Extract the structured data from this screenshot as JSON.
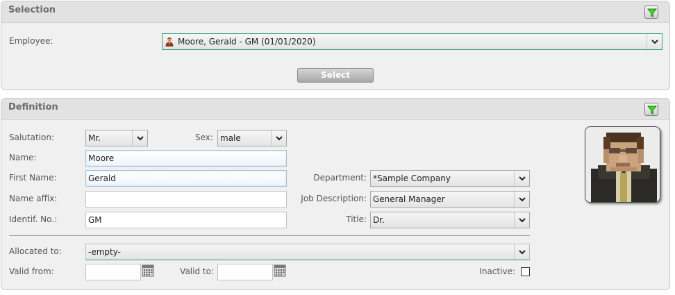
{
  "selection": {
    "title": "Selection",
    "employee_label": "Employee:",
    "employee_value": "Moore, Gerald - GM (01/01/2020)",
    "select_button": "Select"
  },
  "definition": {
    "title": "Definition",
    "salutation": {
      "label": "Salutation:",
      "value": "Mr."
    },
    "sex": {
      "label": "Sex:",
      "value": "male"
    },
    "name": {
      "label": "Name:",
      "value": "Moore"
    },
    "first_name": {
      "label": "First Name:",
      "value": "Gerald"
    },
    "name_affix": {
      "label": "Name affix:",
      "value": ""
    },
    "ident_no": {
      "label": "Identif. No.:",
      "value": "GM"
    },
    "department": {
      "label": "Department:",
      "value": "*Sample Company"
    },
    "job_description": {
      "label": "Job Description:",
      "value": "General Manager"
    },
    "job_title": {
      "label": "Title:",
      "value": "Dr."
    },
    "allocated_to": {
      "label": "Allocated to:",
      "value": "-empty-"
    },
    "valid_from": {
      "label": "Valid from:",
      "value": ""
    },
    "valid_to": {
      "label": "Valid to:",
      "value": ""
    },
    "inactive": {
      "label": "Inactive:",
      "checked": false
    }
  },
  "icons": {
    "filter": "filter-icon",
    "dropdown": "chevron-down-icon",
    "calendar": "calendar-icon",
    "person": "person-icon"
  },
  "colors": {
    "accent_green": "#2e9b80",
    "filter_green": "#3fdc2a",
    "panel_bg": "#f0f0f0",
    "header_bg": "#e2e2e2"
  }
}
